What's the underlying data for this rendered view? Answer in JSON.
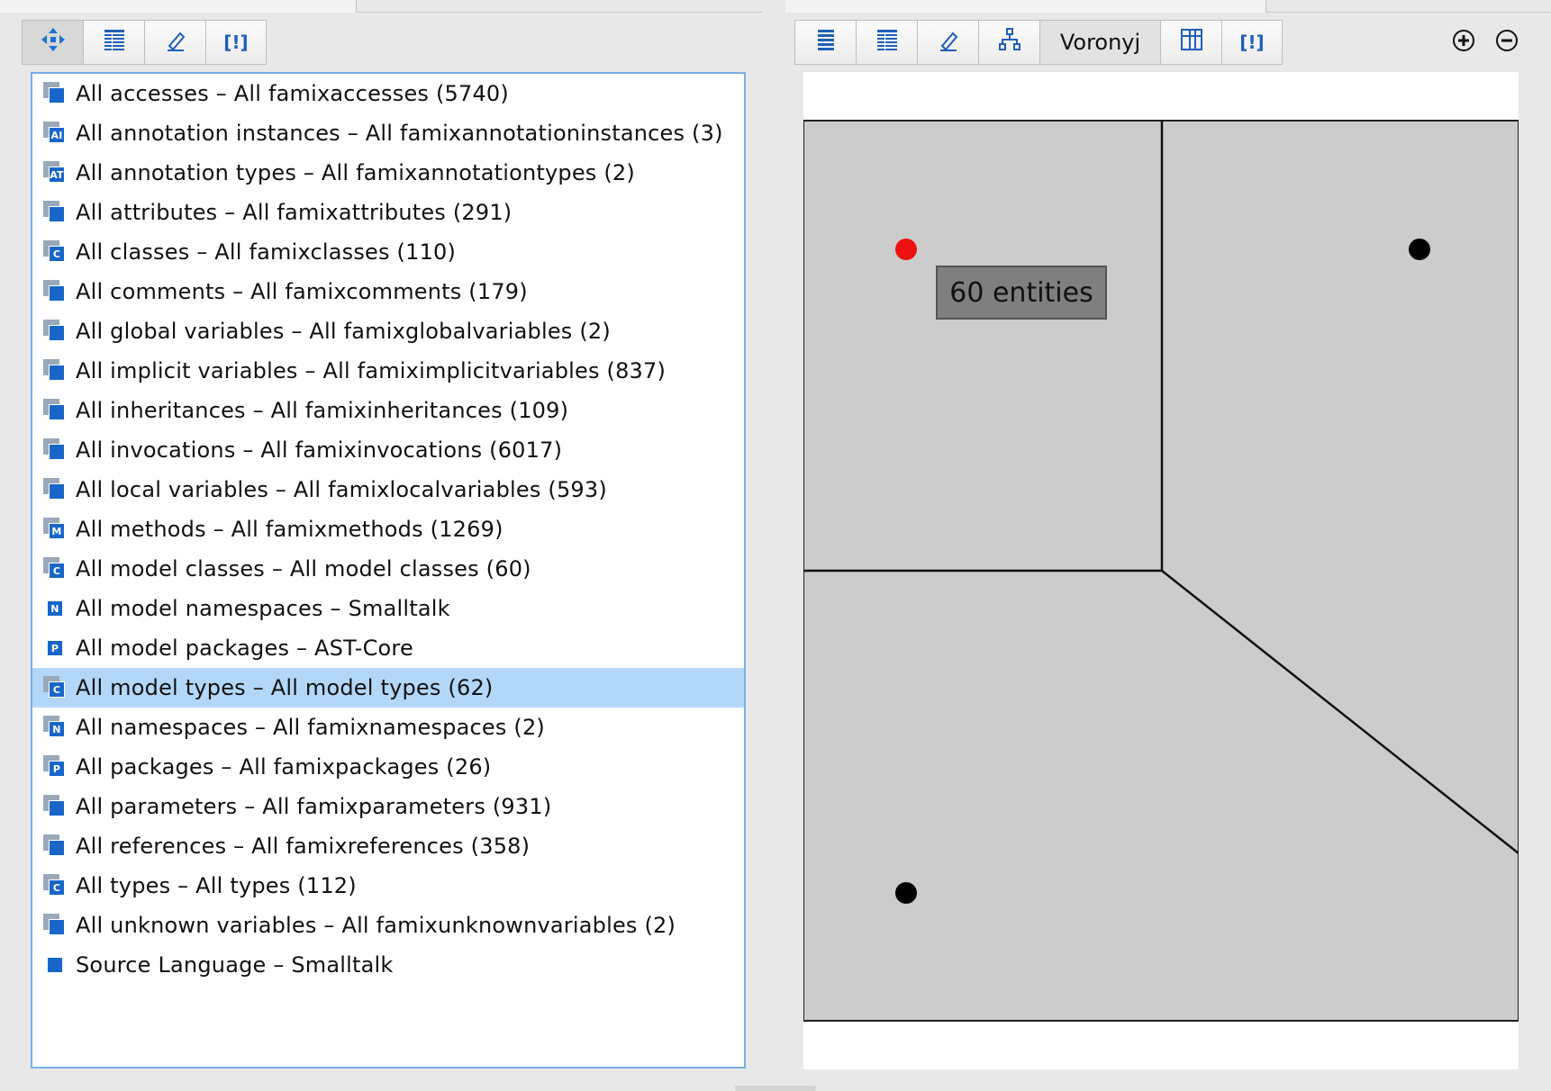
{
  "left_toolbar": {
    "buttons": [
      {
        "icon": "move-arrows-icon",
        "active": true
      },
      {
        "icon": "table-list-icon",
        "active": false
      },
      {
        "icon": "pencil-icon",
        "active": false
      },
      {
        "icon": "brackets-icon",
        "glyph": "[!]",
        "active": false
      }
    ]
  },
  "right_toolbar": {
    "buttons": [
      {
        "icon": "list-lines-icon"
      },
      {
        "icon": "table-list-icon"
      },
      {
        "icon": "pencil-icon"
      },
      {
        "icon": "tree-nodes-icon"
      },
      {
        "label": "Voronyj",
        "active": true
      },
      {
        "icon": "grid-table-icon"
      },
      {
        "icon": "brackets-icon",
        "glyph": "[!]"
      }
    ],
    "zoom_in_icon": "zoom-in-icon",
    "zoom_out_icon": "zoom-out-icon"
  },
  "groups_list": {
    "selected_index": 15,
    "items": [
      {
        "label": "All accesses – All famixaccesses (5740)",
        "icon_letter": ""
      },
      {
        "label": "All annotation instances – All famixannotationinstances (3)",
        "icon_letter": "AI"
      },
      {
        "label": "All annotation types – All famixannotationtypes (2)",
        "icon_letter": "AT"
      },
      {
        "label": "All attributes – All famixattributes (291)",
        "icon_letter": ""
      },
      {
        "label": "All classes – All famixclasses (110)",
        "icon_letter": "C"
      },
      {
        "label": "All comments – All famixcomments (179)",
        "icon_letter": ""
      },
      {
        "label": "All global variables – All famixglobalvariables (2)",
        "icon_letter": ""
      },
      {
        "label": "All implicit variables – All famiximplicitvariables (837)",
        "icon_letter": ""
      },
      {
        "label": "All inheritances – All famixinheritances (109)",
        "icon_letter": ""
      },
      {
        "label": "All invocations – All famixinvocations (6017)",
        "icon_letter": ""
      },
      {
        "label": "All local variables – All famixlocalvariables (593)",
        "icon_letter": ""
      },
      {
        "label": "All methods – All famixmethods (1269)",
        "icon_letter": "M"
      },
      {
        "label": "All model classes – All model classes (60)",
        "icon_letter": "C"
      },
      {
        "label": "All model namespaces – Smalltalk",
        "icon_letter": "N",
        "single": true
      },
      {
        "label": "All model packages – AST-Core",
        "icon_letter": "P",
        "single": true
      },
      {
        "label": "All model types – All model types (62)",
        "icon_letter": "C"
      },
      {
        "label": "All namespaces – All famixnamespaces (2)",
        "icon_letter": "N"
      },
      {
        "label": "All packages – All famixpackages (26)",
        "icon_letter": "P"
      },
      {
        "label": "All parameters – All famixparameters (931)",
        "icon_letter": ""
      },
      {
        "label": "All references – All famixreferences (358)",
        "icon_letter": ""
      },
      {
        "label": "All types – All types (112)",
        "icon_letter": "C"
      },
      {
        "label": "All unknown variables – All famixunknownvariables (2)",
        "icon_letter": ""
      },
      {
        "label": "Source Language – Smalltalk",
        "icon_letter": "",
        "single": true
      }
    ]
  },
  "voronoi": {
    "tooltip": "60 entities",
    "highlight_color": "#ee1111",
    "cell_color": "#cccccc",
    "point_color": "#000000"
  }
}
